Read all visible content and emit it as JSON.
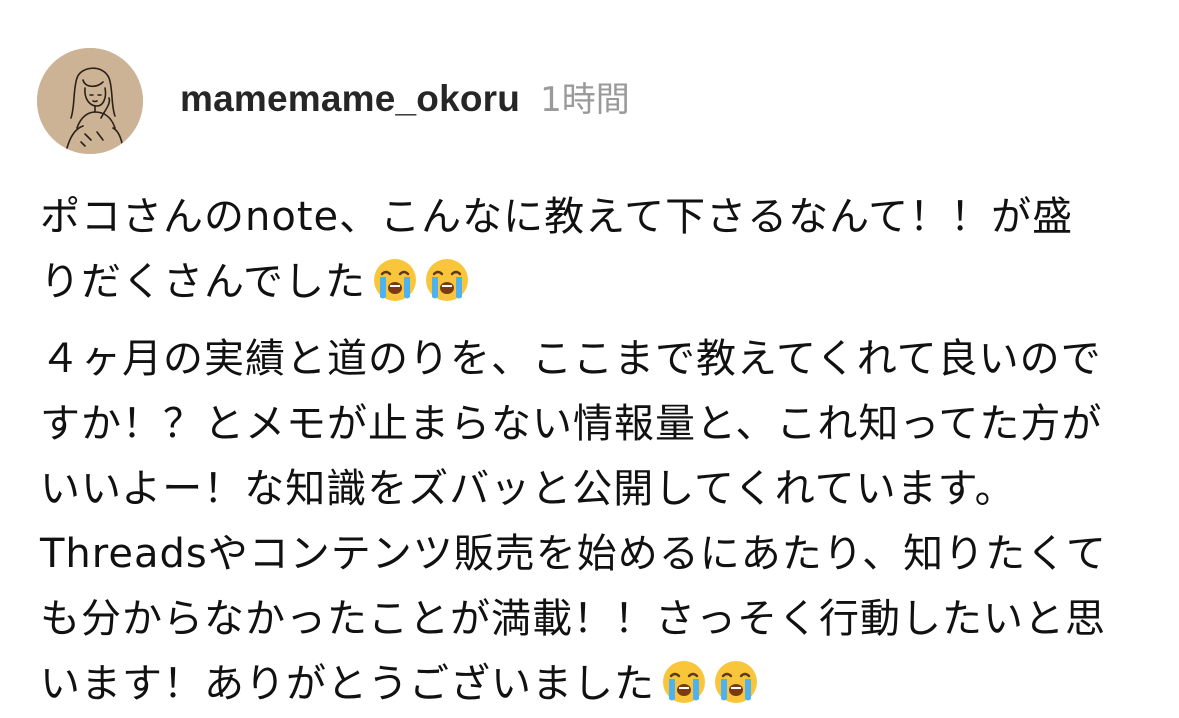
{
  "comment": {
    "username": "mamemame_okoru",
    "time": "1時間",
    "avatar": {
      "icon": "illustrated-girl-avatar",
      "background": "#cdb396"
    },
    "paragraphs": [
      {
        "lines": [
          "ポコさんのnote、こんなに教えて下さるなんて！！が盛",
          "りだくさんでした"
        ],
        "trailing_emoji": [
          "loudly-crying-face-icon",
          "loudly-crying-face-icon"
        ]
      },
      {
        "lines": [
          "４ヶ月の実績と道のりを、ここまで教えてくれて良いので",
          "すか！？とメモが止まらない情報量と、これ知ってた方が",
          "いいよー！な知識をズバッと公開してくれています。",
          "Threadsやコンテンツ販売を始めるにあたり、知りたくて",
          "も分からなかったことが満載！！さっそく行動したいと思",
          "います！ありがとうございました"
        ],
        "trailing_emoji": [
          "loudly-crying-face-icon",
          "loudly-crying-face-icon"
        ]
      }
    ]
  },
  "colors": {
    "username": "#262626",
    "timestamp": "#9a9a9a",
    "text": "#111111",
    "background": "#ffffff"
  }
}
